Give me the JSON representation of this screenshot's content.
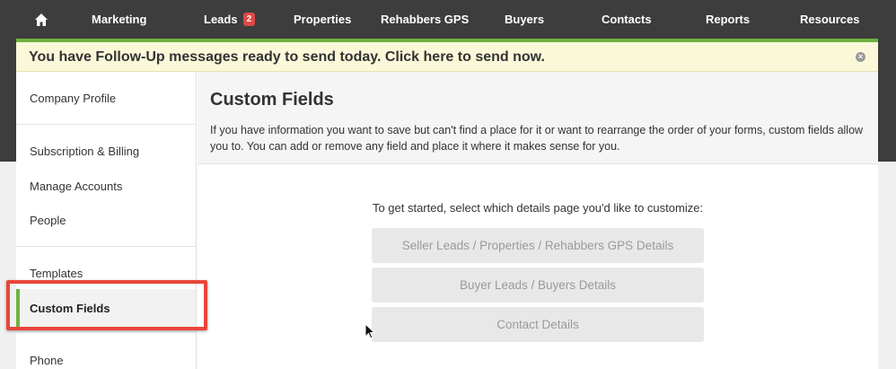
{
  "nav": {
    "home_icon": "home-icon",
    "items": [
      {
        "label": "Marketing"
      },
      {
        "label": "Leads",
        "badge": "2"
      },
      {
        "label": "Properties"
      },
      {
        "label": "Rehabbers GPS"
      },
      {
        "label": "Buyers"
      },
      {
        "label": "Contacts"
      },
      {
        "label": "Reports"
      },
      {
        "label": "Resources"
      }
    ]
  },
  "alert": {
    "text": "You have Follow-Up messages ready to send today. Click here to send now.",
    "close_icon": "close-circle-icon"
  },
  "sidebar": {
    "items": [
      {
        "label": "Company Profile"
      },
      {
        "label": "Subscription & Billing"
      },
      {
        "label": "Manage Accounts"
      },
      {
        "label": "People"
      },
      {
        "label": "Templates"
      },
      {
        "label": "Custom Fields",
        "active": true
      },
      {
        "label": "Phone"
      }
    ]
  },
  "main": {
    "title": "Custom Fields",
    "description": "If you have information you want to save but can't find a place for it or want to rearrange the order of your forms, custom fields allow you to. You can add or remove any field and place it where it makes sense for you.",
    "prompt": "To get started, select which details page you'd like to customize:",
    "buttons": [
      {
        "label": "Seller Leads / Properties / Rehabbers GPS Details"
      },
      {
        "label": "Buyer Leads / Buyers Details"
      },
      {
        "label": "Contact Details"
      }
    ]
  },
  "colors": {
    "nav_bg": "#3d3d3d",
    "accent_green": "#6cb33f",
    "alert_bg": "#fbf8d9",
    "badge_red": "#e04848",
    "highlight_red": "#e8463a"
  }
}
